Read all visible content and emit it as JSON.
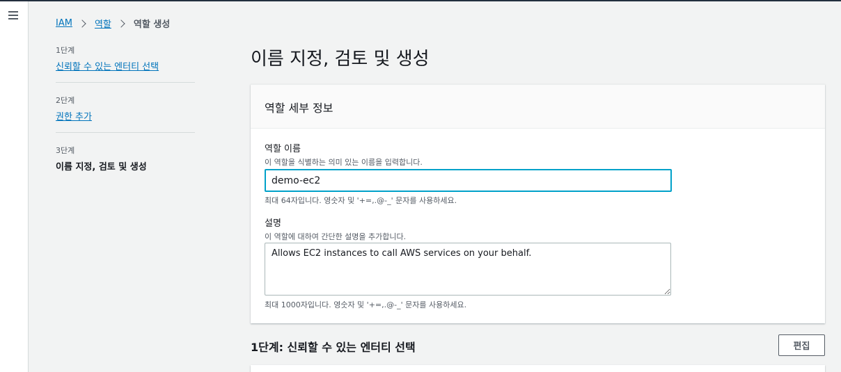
{
  "breadcrumb": {
    "items": [
      "IAM",
      "역할"
    ],
    "current": "역할 생성"
  },
  "steps": [
    {
      "num": "1단계",
      "label": "신뢰할 수 있는 엔터티 선택"
    },
    {
      "num": "2단계",
      "label": "권한 추가"
    },
    {
      "num": "3단계",
      "label": "이름 지정, 검토 및 생성"
    }
  ],
  "page": {
    "title": "이름 지정, 검토 및 생성"
  },
  "role_details": {
    "header": "역할 세부 정보",
    "name_label": "역할 이름",
    "name_desc": "이 역할을 식별하는 의미 있는 이름을 입력합니다.",
    "name_value": "demo-ec2",
    "name_constraint": "최대 64자입니다. 영숫자 및 '+=,.@-_' 문자를 사용하세요.",
    "description_label": "설명",
    "description_desc": "이 역할에 대하여 간단한 설명을 추가합니다.",
    "description_value": "Allows EC2 instances to call AWS services on your behalf.",
    "description_constraint": "최대 1000자입니다. 영숫자 및 '+=,.@-_' 문자를 사용하세요."
  },
  "trusted_section": {
    "title": "1단계: 신뢰할 수 있는 엔터티 선택",
    "edit_label": "편집"
  },
  "colors": {
    "link": "#0073bb",
    "focus": "#00a1c9",
    "background": "#f2f3f3"
  },
  "icons": {
    "menu": "hamburger-menu-icon",
    "separator": "chevron-right-icon"
  }
}
